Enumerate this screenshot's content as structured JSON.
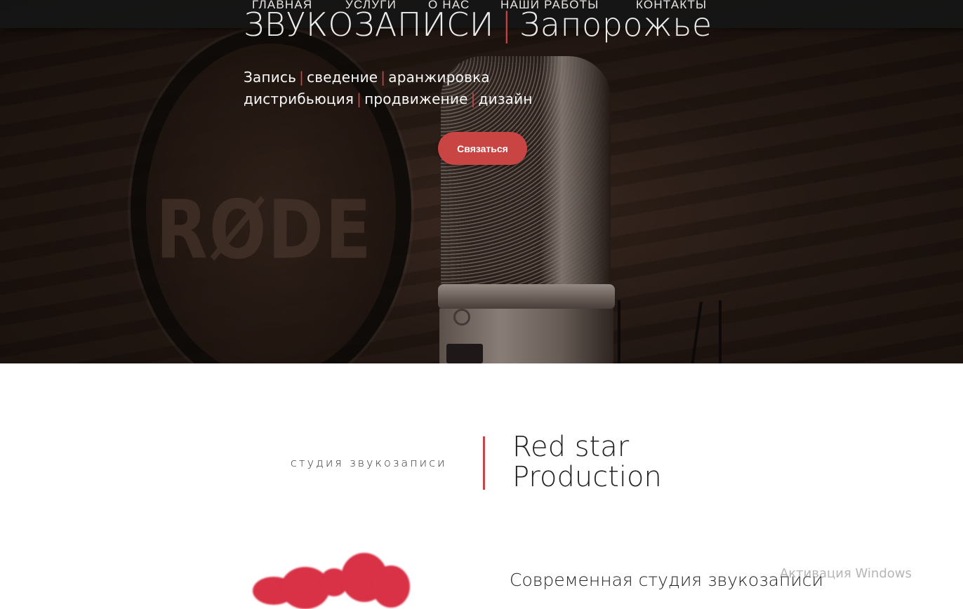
{
  "nav": {
    "items": [
      {
        "label": "ГЛАВНАЯ"
      },
      {
        "label": "УСЛУГИ"
      },
      {
        "label": "О НАС"
      },
      {
        "label": "НАШИ РАБОТЫ"
      },
      {
        "label": "КОНТАКТЫ"
      }
    ]
  },
  "hero": {
    "title_part1": "ЗВУКОЗАПИСИ",
    "title_separator": "|",
    "title_part2": "Запорожье",
    "mic_brand": "RØDE",
    "tagline_line1": [
      "Запись",
      "сведение",
      "аранжировка"
    ],
    "tagline_line2": [
      "дистрибьюция",
      "продвижение",
      "дизайн"
    ],
    "separator": "|",
    "cta_label": "Связаться"
  },
  "studio": {
    "label": "студия звукозаписи",
    "name_line1": "Red star",
    "name_line2": "Production"
  },
  "section": {
    "subheading": "Современная студия звукозаписи"
  },
  "os_watermark": "Активация Windows",
  "colors": {
    "accent": "#c84544",
    "nav_bg": "#161616",
    "text_light": "#fafafa",
    "text_dark": "#222222"
  }
}
